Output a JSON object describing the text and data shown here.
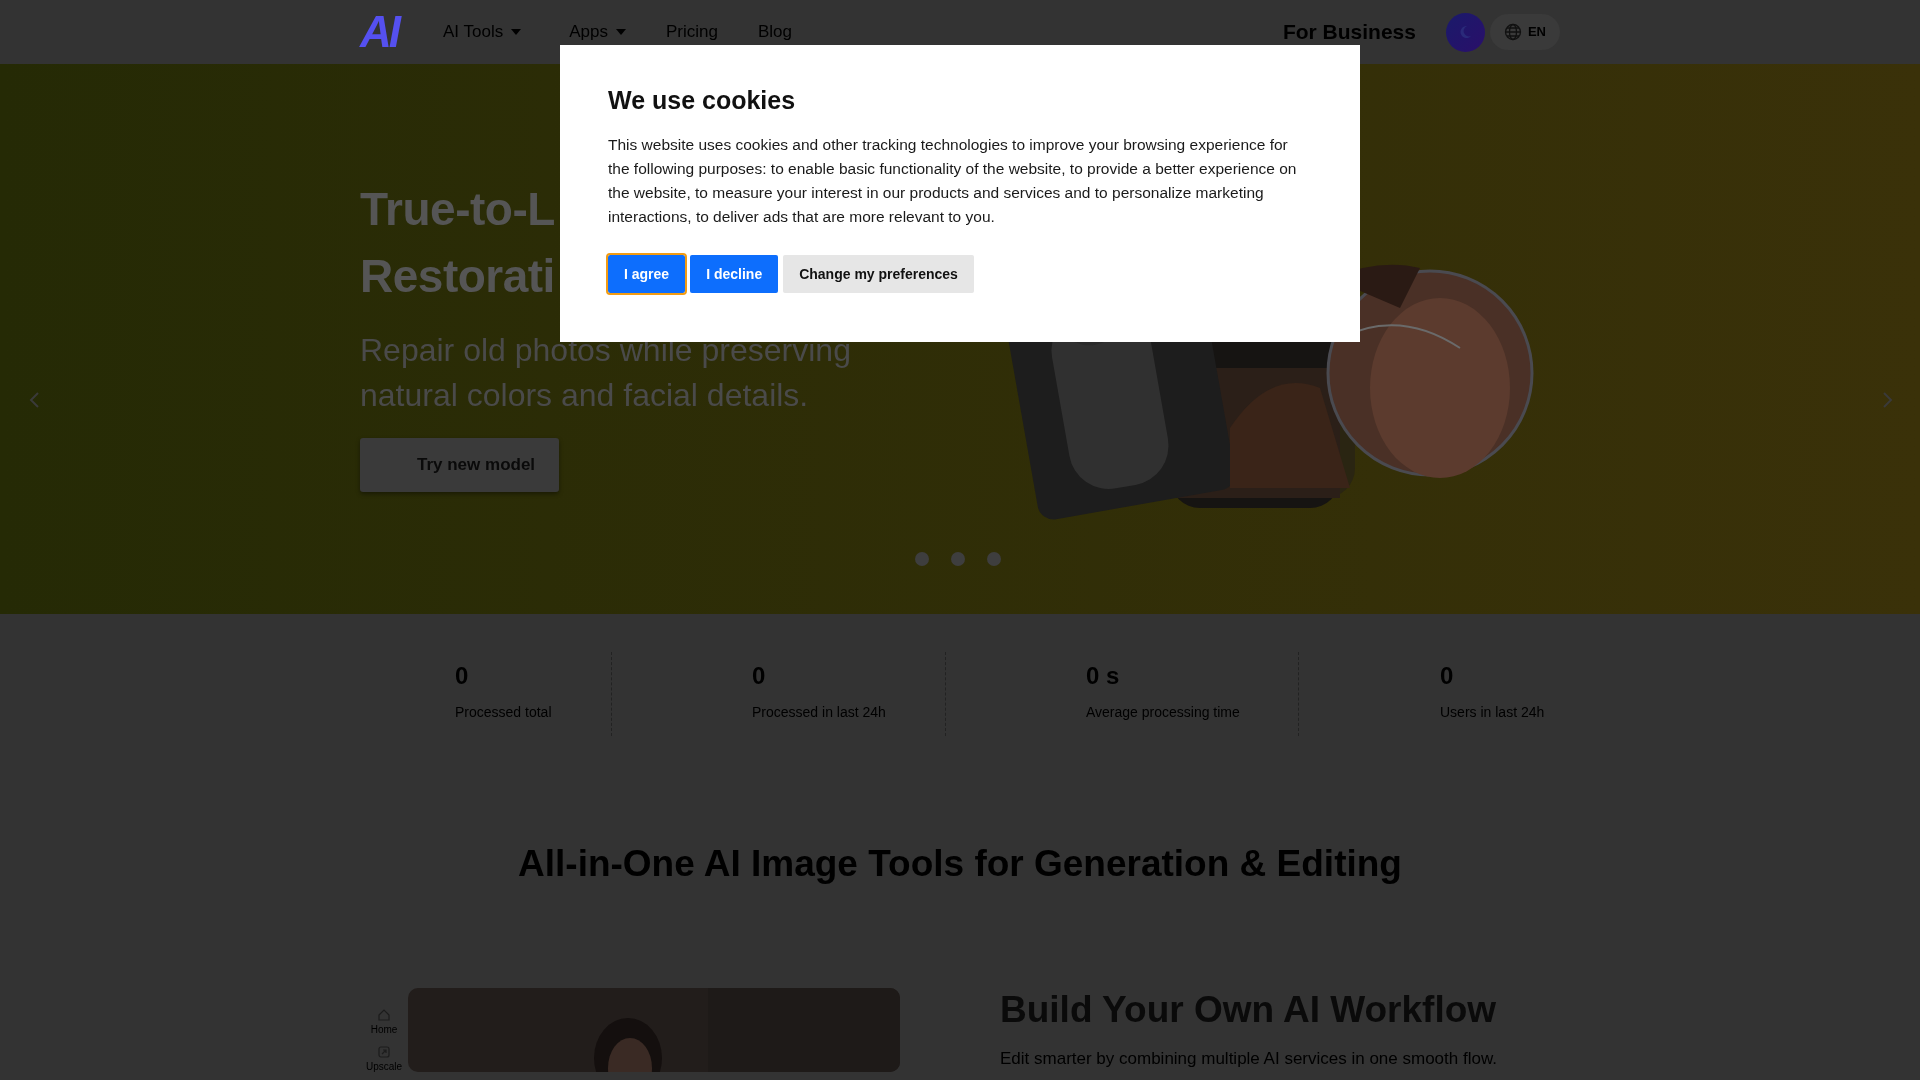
{
  "nav": {
    "logo": "AI",
    "items": [
      {
        "label": "AI Tools",
        "dropdown": true
      },
      {
        "label": "Apps",
        "dropdown": true
      },
      {
        "label": "Pricing",
        "dropdown": false
      },
      {
        "label": "Blog",
        "dropdown": false
      }
    ],
    "business": "For Business",
    "language": "EN"
  },
  "hero": {
    "title_lines": [
      "True-to-L",
      "Restorati"
    ],
    "subtitle": "Repair old photos while preserving natural colors and facial details.",
    "button": "Try new model",
    "slide_dots": [
      {
        "selected": false
      },
      {
        "selected": false
      },
      {
        "selected": false
      }
    ]
  },
  "stats": [
    {
      "value": "0",
      "label": "Processed total"
    },
    {
      "value": "0",
      "label": "Processed in last 24h"
    },
    {
      "value": "0 s",
      "label": "Average processing time"
    },
    {
      "value": "0",
      "label": "Users in last 24h"
    }
  ],
  "section_title": "All-in-One AI Image Tools for Generation & Editing",
  "feature": {
    "sidebar": [
      {
        "label": "Home",
        "kind": "home"
      },
      {
        "label": "Upscale",
        "kind": "upscale"
      }
    ],
    "title": "Build Your Own AI Workflow",
    "text": "Edit smarter by combining multiple AI services in one smooth flow."
  },
  "cookie_dialog": {
    "title": "We use cookies",
    "text": "This website uses cookies and other tracking technologies to improve your browsing experience for the following purposes: to enable basic functionality of the website, to provide a better experience on the website, to measure your interest in our products and services and to personalize marketing interactions, to deliver ads that are more relevant to you.",
    "buttons": [
      {
        "label": "I agree",
        "kind": "primary",
        "focused": true
      },
      {
        "label": "I decline",
        "kind": "primary",
        "focused": false
      },
      {
        "label": "Change my preferences",
        "kind": "secondary",
        "focused": false
      }
    ]
  }
}
